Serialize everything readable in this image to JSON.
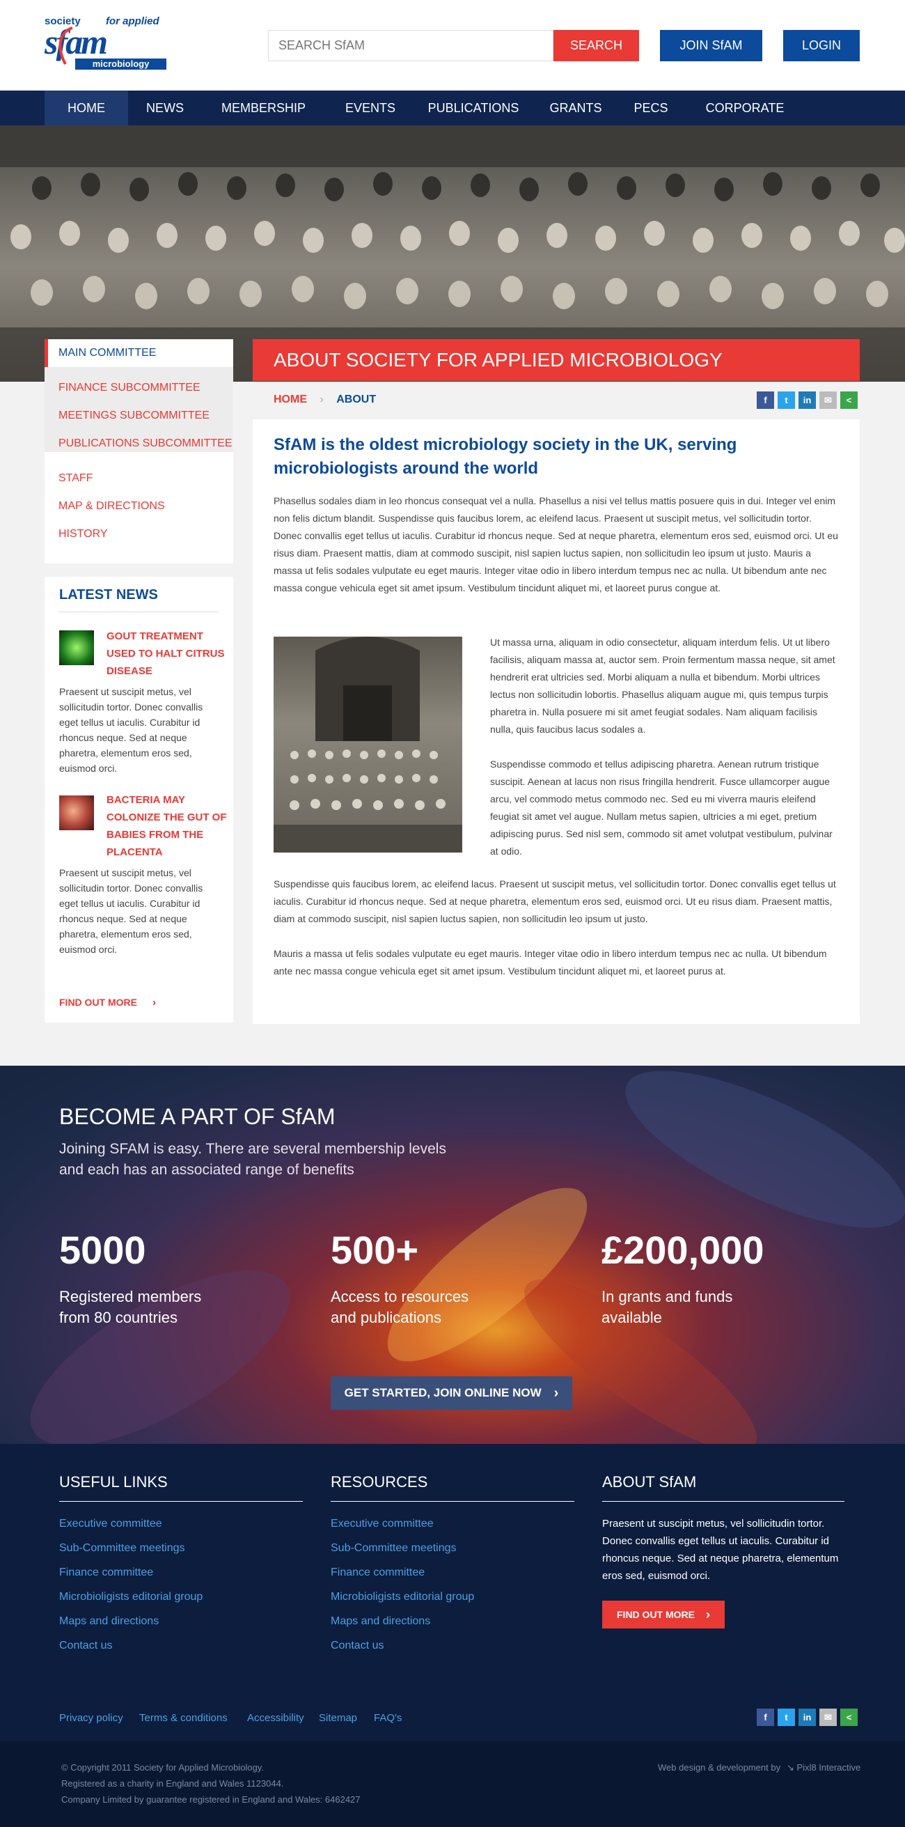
{
  "brand": {
    "line1": "society",
    "line1b": "for applied",
    "mark": "sfam",
    "line2": "microbiology",
    "colors": {
      "red": "#e93a35",
      "blue": "#0c4a9b",
      "navy": "#0f2550"
    }
  },
  "header": {
    "search_placeholder": "SEARCH SfAM",
    "search_label": "SEARCH",
    "join_label": "JOIN SfAM",
    "login_label": "LOGIN"
  },
  "nav": {
    "items": [
      {
        "label": "HOME",
        "active": true
      },
      {
        "label": "NEWS"
      },
      {
        "label": "MEMBERSHIP"
      },
      {
        "label": "EVENTS"
      },
      {
        "label": "PUBLICATIONS"
      },
      {
        "label": "GRANTS"
      },
      {
        "label": "PECS"
      },
      {
        "label": "CORPORATE"
      }
    ]
  },
  "sidebar": {
    "items": [
      {
        "label": "MAIN COMMITTEE",
        "active": true
      },
      {
        "label": "FINANCE SUBCOMMITTEE"
      },
      {
        "label": "MEETINGS SUBCOMMITTEE"
      },
      {
        "label": "PUBLICATIONS SUBCOMMITTEE"
      },
      {
        "label": "STAFF"
      },
      {
        "label": "MAP & DIRECTIONS"
      },
      {
        "label": "HISTORY"
      }
    ]
  },
  "news": {
    "title": "LATEST NEWS",
    "items": [
      {
        "title": "GOUT TREATMENT USED TO HALT CITRUS DISEASE",
        "title_lines": [
          "GOUT TREATMENT",
          "USED TO HALT CITRUS",
          "DISEASE"
        ],
        "body": "Praesent ut suscipit metus, vel sollicitudin tortor. Donec convallis eget tellus ut iaculis. Curabitur id rhoncus neque. Sed at neque pharetra, elementum eros sed, euismod orci."
      },
      {
        "title": "BACTERIA MAY COLONIZE THE GUT OF BABIES FROM THE PLACENTA",
        "title_lines": [
          "BACTERIA MAY",
          "COLONIZE THE GUT OF",
          "BABIES FROM THE",
          "PLACENTA"
        ],
        "body": "Praesent ut suscipit metus, vel sollicitudin tortor. Donec convallis eget tellus ut iaculis. Curabitur id rhoncus neque. Sed at neque pharetra, elementum eros sed, euismod orci."
      }
    ],
    "more_label": "FIND OUT MORE"
  },
  "main": {
    "title": "ABOUT SOCIETY FOR APPLIED MICROBIOLOGY",
    "breadcrumb": {
      "home": "HOME",
      "current": "ABOUT"
    },
    "share": [
      "f",
      "t",
      "in",
      "✉",
      "<"
    ],
    "heading": "SfAM is the oldest microbiology society in the UK, serving microbiologists around the world",
    "p1": "Phasellus sodales diam in leo rhoncus consequat vel a nulla. Phasellus a nisi vel tellus mattis posuere quis in dui. Integer vel enim non felis dictum blandit. Suspendisse quis faucibus lorem, ac eleifend lacus. Praesent ut suscipit metus, vel sollicitudin tortor. Donec convallis eget tellus ut iaculis. Curabitur id rhoncus neque. Sed at neque pharetra, elementum eros sed, euismod orci. Ut eu risus diam. Praesent mattis, diam at commodo suscipit, nisl sapien luctus sapien, non sollicitudin leo ipsum ut justo. Mauris a massa ut felis sodales vulputate eu eget mauris. Integer vitae odio in libero interdum tempus nec ac nulla. Ut bibendum ante nec massa congue vehicula eget sit amet ipsum. Vestibulum tincidunt aliquet mi, et laoreet purus congue at.",
    "p2": "Ut massa urna, aliquam in odio consectetur, aliquam interdum felis. Ut ut libero facilisis, aliquam massa at, auctor sem. Proin fermentum massa neque, sit amet hendrerit erat ultricies sed. Morbi aliquam a nulla et bibendum. Morbi ultrices lectus non sollicitudin lobortis. Phasellus aliquam augue mi, quis tempus turpis pharetra in. Nulla posuere mi sit amet feugiat sodales. Nam aliquam facilisis nulla, quis faucibus lacus sodales a.",
    "p3": "Suspendisse commodo et tellus adipiscing pharetra. Aenean rutrum tristique suscipit. Aenean at lacus non risus fringilla hendrerit. Fusce ullamcorper augue arcu, vel commodo metus commodo nec. Sed eu mi viverra mauris eleifend feugiat sit amet vel augue. Nullam metus sapien, ultricies a mi eget, pretium adipiscing purus. Sed nisl sem, commodo sit amet volutpat vestibulum, pulvinar at odio.",
    "p4": "Suspendisse quis faucibus lorem, ac eleifend lacus. Praesent ut suscipit metus, vel sollicitudin tortor. Donec convallis eget tellus ut iaculis. Curabitur id rhoncus neque. Sed at neque pharetra, elementum eros sed, euismod orci. Ut eu risus diam. Praesent mattis, diam at commodo suscipit, nisl sapien luctus sapien, non sollicitudin leo ipsum ut justo.",
    "p5": "Mauris a massa ut felis sodales vulputate eu eget mauris. Integer vitae odio in libero interdum tempus nec ac nulla. Ut bibendum ante nec massa congue vehicula eget sit amet ipsum. Vestibulum tincidunt aliquet mi, et laoreet purus at."
  },
  "join": {
    "title": "BECOME A PART OF SfAM",
    "subtitle": "Joining SFAM is easy. There are several membership levels and each has an associated range of benefits",
    "stats": [
      {
        "value": "5000",
        "label1": "Registered members",
        "label2": "from 80 countries"
      },
      {
        "value": "500+",
        "label1": "Access to resources",
        "label2": "and publications"
      },
      {
        "value": "£200,000",
        "label1": "In grants and funds",
        "label2": "available"
      }
    ],
    "cta": "GET STARTED, JOIN ONLINE NOW"
  },
  "footer": {
    "useful_title": "USEFUL LINKS",
    "useful": [
      "Executive committee",
      "Sub-Committee meetings",
      "Finance committee",
      "Microbioligists editorial group",
      "Maps and directions",
      "Contact us"
    ],
    "resources_title": "RESOURCES",
    "resources": [
      "Executive committee",
      "Sub-Committee meetings",
      "Finance committee",
      "Microbioligists editorial group",
      "Maps and directions",
      "Contact us"
    ],
    "about_title": "ABOUT SfAM",
    "about_text": "Praesent ut suscipit metus, vel sollicitudin tortor. Donec convallis eget tellus ut iaculis. Curabitur id rhoncus neque. Sed at neque pharetra, elementum eros sed, euismod orci.",
    "about_btn": "FIND OUT MORE",
    "bottom_links": [
      "Privacy policy",
      "Terms & conditions",
      "Accessibility",
      "Sitemap",
      "FAQ's"
    ],
    "copyright1": "© Copyright 2011 Society for Applied Microbiology.",
    "copyright2": "Registered as a charity in England and Wales 1123044.",
    "copyright3": "Company Limited by guarantee registered in England and Wales: 6462427",
    "credit": "Web design & development by",
    "credit_name": "↘ Pixl8 Interactive"
  }
}
